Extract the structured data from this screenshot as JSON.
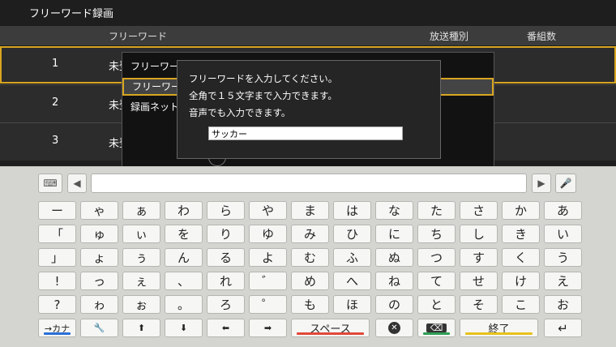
{
  "screen": {
    "title": "フリーワード録画",
    "headers": {
      "keyword": "フリーワード",
      "type": "放送種別",
      "count": "番組数"
    },
    "rows": [
      {
        "num": "1",
        "name": "未登録"
      },
      {
        "num": "2",
        "name": "未登録"
      },
      {
        "num": "3",
        "name": "未登録"
      }
    ],
    "menu_items": [
      "フリーワード",
      "フリーワード",
      "録画ネット"
    ]
  },
  "dialog": {
    "line1": "フリーワードを入力してください。",
    "line2": "全角で１５文字まで入力できます。",
    "line3": "音声でも入力できます。",
    "input_value": "サッカー"
  },
  "keyboard": {
    "rows": [
      [
        "ー",
        "ゃ",
        "ぁ",
        "わ",
        "ら",
        "や",
        "ま",
        "は",
        "な",
        "た",
        "さ",
        "か",
        "あ"
      ],
      [
        "「",
        "ゅ",
        "ぃ",
        "を",
        "り",
        "ゆ",
        "み",
        "ひ",
        "に",
        "ち",
        "し",
        "き",
        "い"
      ],
      [
        "」",
        "ょ",
        "ぅ",
        "ん",
        "る",
        "よ",
        "む",
        "ふ",
        "ぬ",
        "つ",
        "す",
        "く",
        "う"
      ],
      [
        "!",
        "っ",
        "ぇ",
        "、",
        "れ",
        "゛",
        "め",
        "へ",
        "ね",
        "て",
        "せ",
        "け",
        "え"
      ],
      [
        "?",
        "ゎ",
        "ぉ",
        "。",
        "ろ",
        "゜",
        "も",
        "ほ",
        "の",
        "と",
        "そ",
        "こ",
        "お"
      ]
    ],
    "bottom": {
      "kana": "→カナ",
      "wrench": "🔧",
      "up": "⬆",
      "down": "⬇",
      "left": "⬅",
      "right": "➡",
      "space": "スペース",
      "x": "✕",
      "del": "⌫",
      "done": "終了",
      "enter": "↵"
    },
    "top": {
      "kbd_icon": "⌨",
      "left_arrow": "◀",
      "right_arrow": "▶",
      "mic": "🎤"
    },
    "colors": {
      "blue": "#2a6fd8",
      "red": "#e0483a",
      "green": "#2f9e54",
      "yellow": "#e6c21c"
    }
  }
}
